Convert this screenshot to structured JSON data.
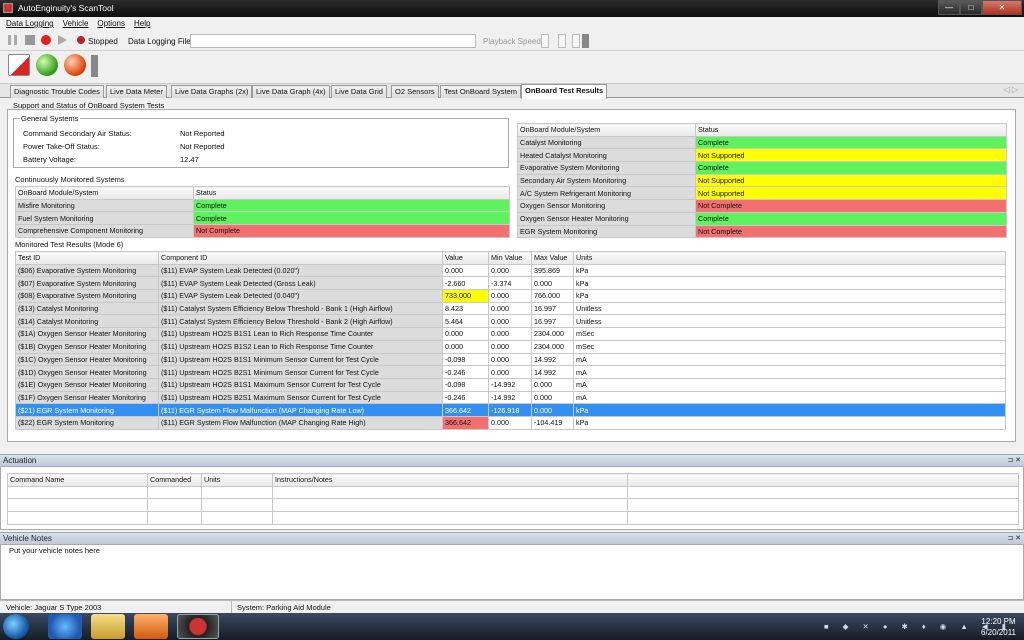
{
  "window": {
    "title": "AutoEnginuity's ScanTool",
    "minimize": "—",
    "maximize": "□",
    "close": "✕"
  },
  "menu": [
    "Data Logging",
    "Vehicle",
    "Options",
    "Help"
  ],
  "toolbar": {
    "status": "Stopped",
    "logging_file_label": "Data Logging File",
    "logging_file_value": "",
    "playback_label": "Playback Speed"
  },
  "tabs": [
    "Diagnostic Trouble Codes",
    "Live Data Meter",
    "Live Data Graphs (2x)",
    "Live Data Graph (4x)",
    "Live Data Grid",
    "O2 Sensors",
    "Test OnBoard System",
    "OnBoard Test Results"
  ],
  "active_tab": "OnBoard Test Results",
  "section_title": "Support and Status of OnBoard System Tests",
  "general": {
    "title": "General Systems",
    "rows": [
      {
        "label": "Command Secondary Air Status:",
        "value": "Not Reported"
      },
      {
        "label": "Power Take-Off Status:",
        "value": "Not Reported"
      },
      {
        "label": "Battery Voltage:",
        "value": "12.47"
      }
    ]
  },
  "continuous": {
    "title": "Continuously Monitored Systems",
    "headers": [
      "OnBoard Module/System",
      "Status"
    ],
    "rows": [
      {
        "name": "Misfire Monitoring",
        "status": "Complete",
        "color": "g"
      },
      {
        "name": "Fuel System Monitoring",
        "status": "Complete",
        "color": "g"
      },
      {
        "name": "Comprehensive Component Monitoring",
        "status": "Not Complete",
        "color": "r"
      }
    ]
  },
  "noncont": {
    "headers": [
      "OnBoard Module/System",
      "Status"
    ],
    "rows": [
      {
        "name": "Catalyst Monitoring",
        "status": "Complete",
        "color": "g"
      },
      {
        "name": "Heated Catalyst Monitoring",
        "status": "Not Supported",
        "color": "y"
      },
      {
        "name": "Evaporative System Monitoring",
        "status": "Complete",
        "color": "g"
      },
      {
        "name": "Secondary Air System Monitoring",
        "status": "Not Supported",
        "color": "y"
      },
      {
        "name": "A/C System Refrigerant Monitoring",
        "status": "Not Supported",
        "color": "y"
      },
      {
        "name": "Oxygen Sensor Monitoring",
        "status": "Not Complete",
        "color": "r"
      },
      {
        "name": "Oxygen Sensor Heater Monitoring",
        "status": "Complete",
        "color": "g"
      },
      {
        "name": "EGR System Monitoring",
        "status": "Not Complete",
        "color": "r"
      }
    ]
  },
  "results": {
    "title": "Monitored Test Results (Mode 6)",
    "headers": [
      "Test ID",
      "Component ID",
      "Value",
      "Min Value",
      "Max Value",
      "Units"
    ],
    "rows": [
      {
        "test": "($06)  Evaporative System Monitoring",
        "comp": "($11)  EVAP System Leak Detected (0.020\")",
        "value": "0.000",
        "min": "0.000",
        "max": "395.869",
        "units": "kPa",
        "hl": ""
      },
      {
        "test": "($07)  Evaporative System Monitoring",
        "comp": "($11)  EVAP System Leak Detected (Gross Leak)",
        "value": "-2.660",
        "min": "-3.374",
        "max": "0.000",
        "units": "kPa",
        "hl": ""
      },
      {
        "test": "($08)  Evaporative System Monitoring",
        "comp": "($11)  EVAP System Leak Detected (0.040\")",
        "value": "733.000",
        "min": "0.000",
        "max": "766.000",
        "units": "kPa",
        "hl": "y"
      },
      {
        "test": "($13)  Catalyst Monitoring",
        "comp": "($11)  Catalyst System Efficiency Below Threshold - Bank 1 (High Airflow)",
        "value": "8.423",
        "min": "0.000",
        "max": "16.997",
        "units": "Unitless",
        "hl": ""
      },
      {
        "test": "($14)  Catalyst Monitoring",
        "comp": "($11)  Catalyst System Efficiency Below Threshold - Bank 2 (High Airflow)",
        "value": "5.464",
        "min": "0.000",
        "max": "16.997",
        "units": "Unitless",
        "hl": ""
      },
      {
        "test": "($1A)  Oxygen Sensor Heater Monitoring",
        "comp": "($11)  Upstream HO2S B1S1 Lean to Rich Response Time Counter",
        "value": "0.000",
        "min": "0.000",
        "max": "2304.000",
        "units": "mSec",
        "hl": ""
      },
      {
        "test": "($1B)  Oxygen Sensor Heater Monitoring",
        "comp": "($11)  Upstream HO2S B1S2 Lean to Rich Response Time Counter",
        "value": "0.000",
        "min": "0.000",
        "max": "2304.000",
        "units": "mSec",
        "hl": ""
      },
      {
        "test": "($1C)  Oxygen Sensor Heater Monitoring",
        "comp": "($11)  Upstream HO2S B1S1 Minimum Sensor Current for Test Cycle",
        "value": "-0.098",
        "min": "0.000",
        "max": "14.992",
        "units": "mA",
        "hl": ""
      },
      {
        "test": "($1D)  Oxygen Sensor Heater Monitoring",
        "comp": "($11)  Upstream HO2S B2S1 Minimum Sensor Current for Test Cycle",
        "value": "-0.246",
        "min": "0.000",
        "max": "14.992",
        "units": "mA",
        "hl": ""
      },
      {
        "test": "($1E)  Oxygen Sensor Heater Monitoring",
        "comp": "($11)  Upstream HO2S B1S1 Maximum Sensor Current for Test Cycle",
        "value": "-0.098",
        "min": "-14.992",
        "max": "0.000",
        "units": "mA",
        "hl": ""
      },
      {
        "test": "($1F)  Oxygen Sensor Heater Monitoring",
        "comp": "($11)  Upstream HO2S B2S1 Maximum Sensor Current for Test Cycle",
        "value": "-0.246",
        "min": "-14.992",
        "max": "0.000",
        "units": "mA",
        "hl": ""
      },
      {
        "test": "($21)  EGR System Monitoring",
        "comp": "($11)  EGR System Flow Malfunction (MAP Changing Rate Low)",
        "value": "366.642",
        "min": "-126.918",
        "max": "0.000",
        "units": "kPa",
        "hl": "sel"
      },
      {
        "test": "($22)  EGR System Monitoring",
        "comp": "($11)  EGR System Flow Malfunction (MAP Changing Rate High)",
        "value": "366.642",
        "min": "0.000",
        "max": "-104.419",
        "units": "kPa",
        "hl": "r"
      }
    ]
  },
  "actuation": {
    "title": "Actuation",
    "headers": [
      "Command Name",
      "Commanded",
      "Units",
      "Instructions/Notes"
    ]
  },
  "notes": {
    "title": "Vehicle Notes",
    "placeholder": "Put your vehicle notes here"
  },
  "status": {
    "vehicle": "Vehicle: Jaguar  S Type  2003",
    "system": "System: Parking Aid Module"
  },
  "clock": {
    "time": "12:20 PM",
    "date": "6/20/2011"
  }
}
